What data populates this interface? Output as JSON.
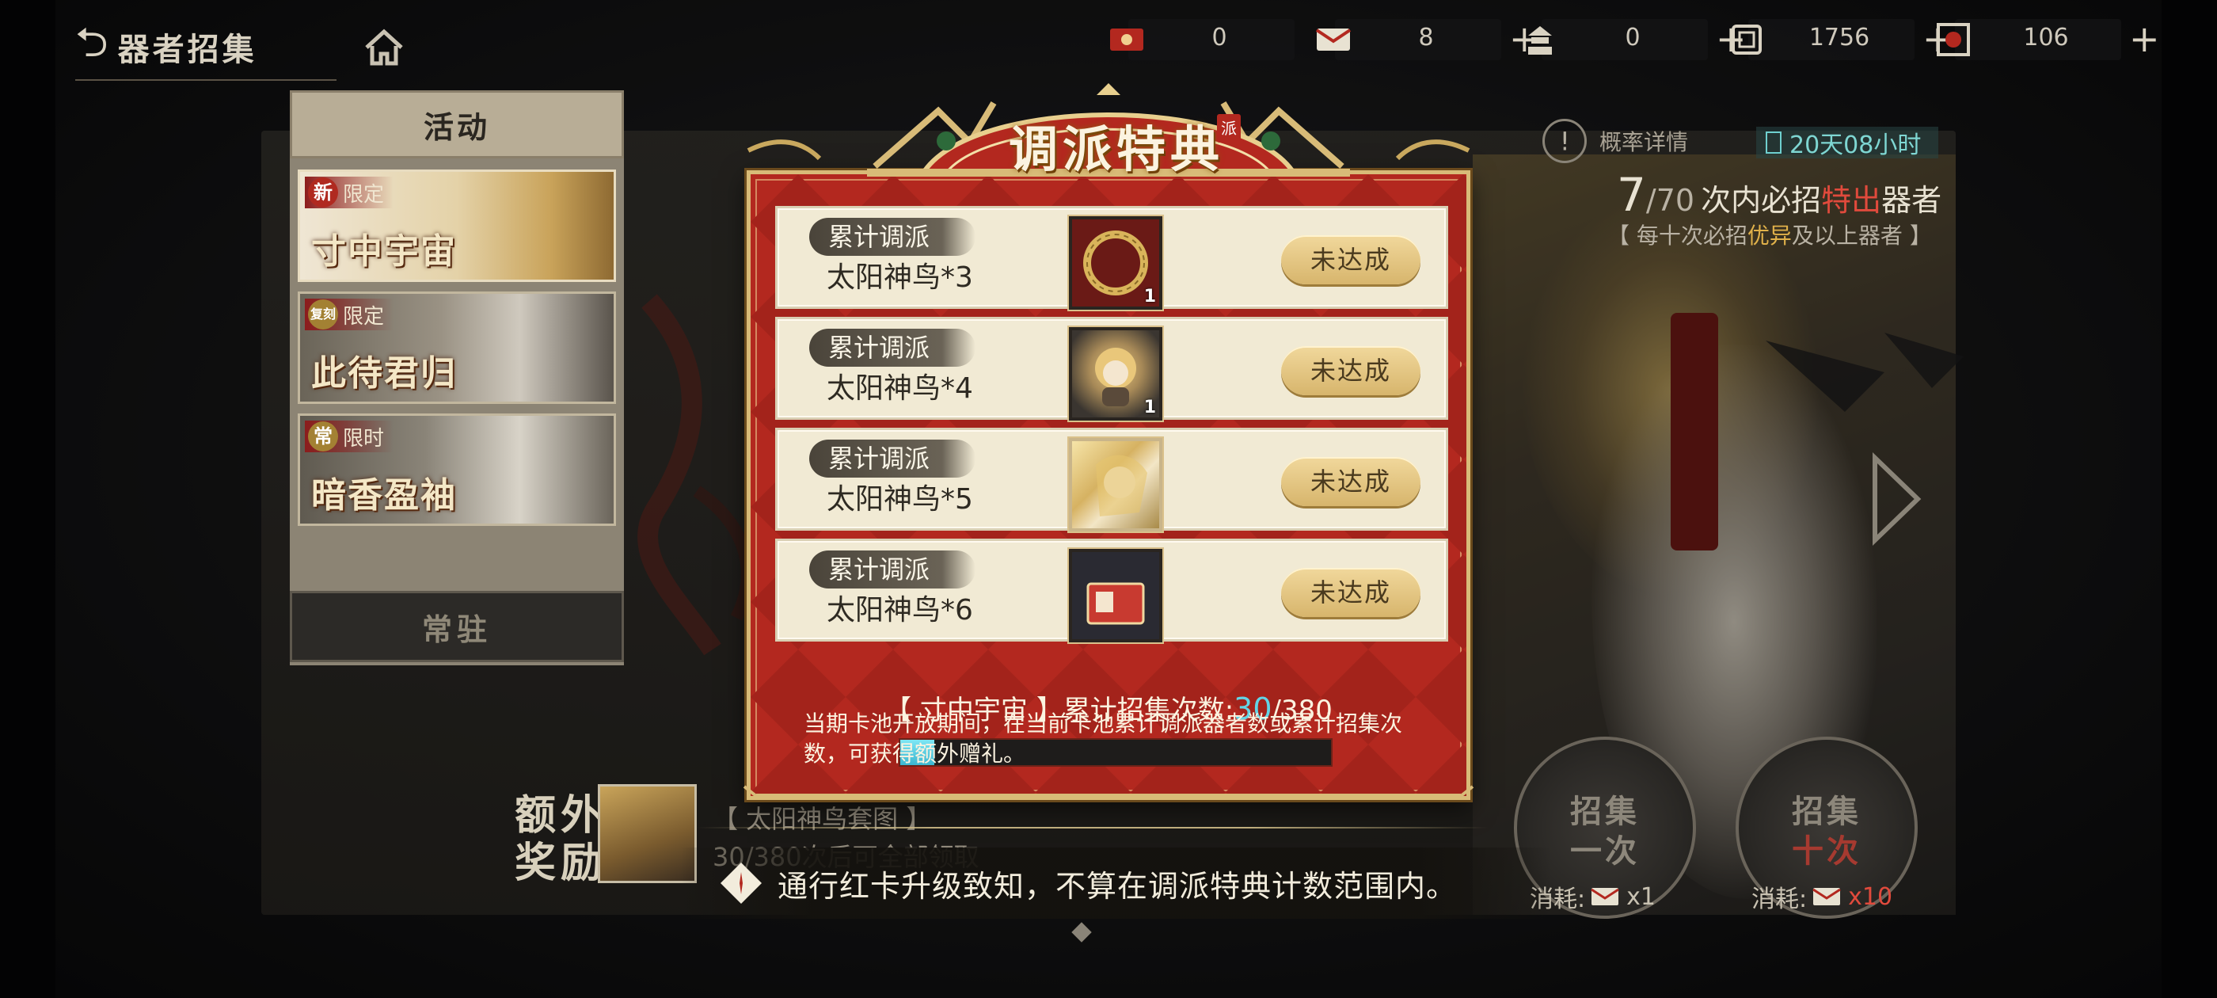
{
  "header": {
    "back_label": "器者招集",
    "currencies": [
      {
        "icon": "red-ticket-icon",
        "value": "0",
        "has_plus": false
      },
      {
        "icon": "envelope-ticket-icon",
        "value": "8",
        "has_plus": true
      },
      {
        "icon": "pagoda-token-icon",
        "value": "0",
        "has_plus": true
      },
      {
        "icon": "seal-coin-icon",
        "value": "1756",
        "has_plus": true
      },
      {
        "icon": "crystal-icon",
        "value": "106",
        "has_plus": true
      }
    ],
    "plus_symbol": "+"
  },
  "sidebar": {
    "header": "活动",
    "banners": [
      {
        "seal": "新",
        "tag": "限定",
        "name": "寸中宇宙"
      },
      {
        "seal": "复刻",
        "tag": "限定",
        "name": "此待君归"
      },
      {
        "seal": "常",
        "tag": "限时",
        "name": "暗香盈袖"
      }
    ],
    "normal": "常驻"
  },
  "info": {
    "rate_label": "概率详情",
    "timer": "20天08小时",
    "pity_current": "7",
    "pity_total": "70",
    "pity_text_1": "次内必招",
    "pity_text_red": "特出",
    "pity_text_2": "器者",
    "pity_sub_1": "【 每十次必招",
    "pity_sub_gold": "优异",
    "pity_sub_2": "及以上器者 】"
  },
  "modal": {
    "title": "调派特典",
    "stamp": "派",
    "rewards": [
      {
        "chip": "累计调派",
        "desc": "太阳神鸟*3",
        "count": "1",
        "status": "未达成"
      },
      {
        "chip": "累计调派",
        "desc": "太阳神鸟*4",
        "count": "1",
        "status": "未达成"
      },
      {
        "chip": "累计调派",
        "desc": "太阳神鸟*5",
        "count": "",
        "status": "未达成"
      },
      {
        "chip": "累计调派",
        "desc": "太阳神鸟*6",
        "count": "",
        "status": "未达成"
      }
    ],
    "count_prefix": "【 寸中宇宙 】累计招集次数:",
    "count_current": "30",
    "count_max": "/380",
    "progress_fraction": 0.079,
    "note": "当期卡池开放期间，在当前卡池累计调派器者数或累计招集次数，可获得额外赠礼。"
  },
  "extra": {
    "label_1": "额外",
    "label_2": "奖励",
    "text_1": "【 太阳神鸟套图 】",
    "text_2": "30/380次后可全部领取"
  },
  "pull": {
    "single_1": "招集",
    "single_2": "一次",
    "ten_1": "招集",
    "ten_2": "十次",
    "cost_label": "消耗:",
    "single_cost": "x1",
    "ten_cost": "x10"
  },
  "toast": "通行红卡升级致知，不算在调派特典计数范围内。",
  "colors": {
    "modal_red": "#b3281f",
    "progress": "#3cb6d0",
    "accent_red": "#e04a3c",
    "gold": "#e0b14a"
  }
}
